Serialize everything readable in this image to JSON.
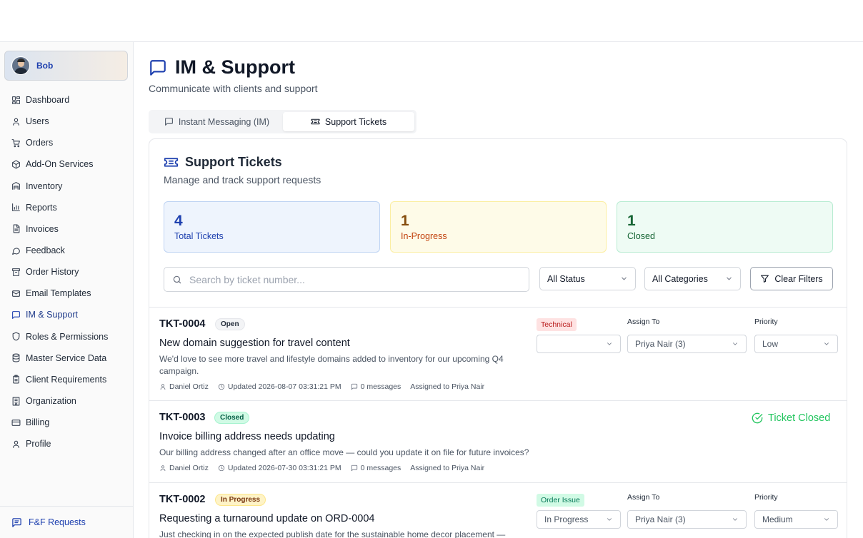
{
  "sidebar": {
    "user_name": "Bob",
    "items": [
      {
        "label": "Dashboard",
        "icon": "dashboard-icon"
      },
      {
        "label": "Users",
        "icon": "user-icon"
      },
      {
        "label": "Orders",
        "icon": "cart-icon"
      },
      {
        "label": "Add-On Services",
        "icon": "package-icon"
      },
      {
        "label": "Inventory",
        "icon": "warehouse-icon"
      },
      {
        "label": "Reports",
        "icon": "bar-chart-icon"
      },
      {
        "label": "Invoices",
        "icon": "file-icon"
      },
      {
        "label": "Feedback",
        "icon": "message-circle-icon"
      },
      {
        "label": "Order History",
        "icon": "archive-icon"
      },
      {
        "label": "Email Templates",
        "icon": "mail-icon"
      },
      {
        "label": "IM & Support",
        "icon": "message-square-icon",
        "active": true
      },
      {
        "label": "Roles & Permissions",
        "icon": "shield-icon"
      },
      {
        "label": "Master Service Data",
        "icon": "database-icon"
      },
      {
        "label": "Client Requirements",
        "icon": "clipboard-icon"
      },
      {
        "label": "Organization",
        "icon": "building-icon"
      },
      {
        "label": "Billing",
        "icon": "credit-card-icon"
      },
      {
        "label": "Profile",
        "icon": "user-icon"
      }
    ],
    "footer_label": "F&F Requests"
  },
  "page": {
    "title": "IM & Support",
    "subtitle": "Communicate with clients and support"
  },
  "tabs": [
    {
      "label": "Instant Messaging (IM)",
      "active": false
    },
    {
      "label": "Support Tickets",
      "active": true
    }
  ],
  "support": {
    "title": "Support Tickets",
    "subtitle": "Manage and track support requests",
    "stats": {
      "total": {
        "value": "4",
        "label": "Total Tickets"
      },
      "in_progress": {
        "value": "1",
        "label": "In-Progress"
      },
      "closed": {
        "value": "1",
        "label": "Closed"
      }
    },
    "filters": {
      "search_placeholder": "Search by ticket number...",
      "status": "All Status",
      "category": "All Categories",
      "clear_label": "Clear Filters"
    },
    "field_labels": {
      "assign": "Assign To",
      "priority": "Priority"
    },
    "tickets": [
      {
        "id": "TKT-0004",
        "status": "Open",
        "title": "New domain suggestion for travel content",
        "description": "We'd love to see more travel and lifestyle domains added to inventory for our upcoming Q4 campaign.",
        "author": "Daniel Ortiz",
        "updated": "Updated 2026-08-07 03:31:21 PM",
        "messages": "0 messages",
        "assigned": "Assigned to Priya Nair",
        "category": "Technical",
        "status_select": "",
        "assign_to": "Priya Nair (3)",
        "priority": "Low"
      },
      {
        "id": "TKT-0003",
        "status": "Closed",
        "title": "Invoice billing address needs updating",
        "description": "Our billing address changed after an office move — could you update it on file for future invoices?",
        "author": "Daniel Ortiz",
        "updated": "Updated 2026-07-30 03:31:21 PM",
        "messages": "0 messages",
        "assigned": "Assigned to Priya Nair",
        "closed_label": "Ticket Closed"
      },
      {
        "id": "TKT-0002",
        "status": "In Progress",
        "title": "Requesting a turnaround update on ORD-0004",
        "description": "Just checking in on the expected publish date for the sustainable home decor placement —",
        "category": "Order Issue",
        "status_select": "In Progress",
        "assign_to": "Priya Nair (3)",
        "priority": "Medium"
      }
    ]
  }
}
